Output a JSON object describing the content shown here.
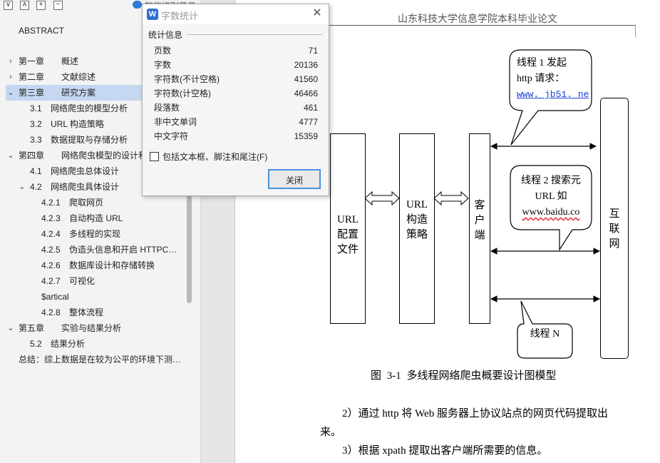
{
  "nav": {
    "pane_title": "智能识别目录",
    "top_buttons": [
      "∨",
      "∧",
      "+",
      "−"
    ],
    "items": [
      {
        "num": "",
        "text": "ABSTRACT",
        "level": 0,
        "chevron": ""
      },
      {
        "num": "第一章",
        "text": "概述",
        "level": 0,
        "chevron": "›"
      },
      {
        "num": "第二章",
        "text": "文献综述",
        "level": 0,
        "chevron": "›"
      },
      {
        "num": "第三章",
        "text": "研究方案",
        "level": 0,
        "chevron": "⌄",
        "selected": true
      },
      {
        "num": "3.1",
        "text": "网络爬虫的模型分析",
        "level": 1,
        "chevron": ""
      },
      {
        "num": "3.2",
        "text": "URL 构造策略",
        "level": 1,
        "chevron": ""
      },
      {
        "num": "3.3",
        "text": "数据提取与存储分析",
        "level": 1,
        "chevron": ""
      },
      {
        "num": "第四章",
        "text": "网络爬虫模型的设计和",
        "level": 0,
        "chevron": "⌄"
      },
      {
        "num": "4.1",
        "text": "网络爬虫总体设计",
        "level": 1,
        "chevron": ""
      },
      {
        "num": "4.2",
        "text": "网络爬虫具体设计",
        "level": 1,
        "chevron": "⌄"
      },
      {
        "num": "4.2.1",
        "text": "爬取网页",
        "level": 2,
        "chevron": ""
      },
      {
        "num": "4.2.3",
        "text": "自动构造 URL",
        "level": 2,
        "chevron": ""
      },
      {
        "num": "4.2.4",
        "text": "多线程的实现",
        "level": 2,
        "chevron": ""
      },
      {
        "num": "4.2.5",
        "text": "伪造头信息和开启 HTTPC…",
        "level": 2,
        "chevron": ""
      },
      {
        "num": "4.2.6",
        "text": "数据库设计和存储转换",
        "level": 2,
        "chevron": ""
      },
      {
        "num": "4.2.7",
        "text": "可视化",
        "level": 2,
        "chevron": ""
      },
      {
        "num": "",
        "text": "$artical",
        "level": 2,
        "chevron": ""
      },
      {
        "num": "4.2.8",
        "text": "整体流程",
        "level": 2,
        "chevron": ""
      },
      {
        "num": "第五章",
        "text": "实验与结果分析",
        "level": 0,
        "chevron": "⌄"
      },
      {
        "num": "5.2",
        "text": "结果分析",
        "level": 1,
        "chevron": ""
      },
      {
        "num": "",
        "text": "总结：综上数据是在较为公平的环境下测…",
        "level": 0,
        "chevron": ""
      }
    ]
  },
  "dialog": {
    "title": "字数统计",
    "icon_letter": "W",
    "close_glyph": "✕",
    "section": "统计信息",
    "stats": [
      {
        "label": "页数",
        "value": "71"
      },
      {
        "label": "字数",
        "value": "20136"
      },
      {
        "label": "字符数(不计空格)",
        "value": "41560"
      },
      {
        "label": "字符数(计空格)",
        "value": "46466"
      },
      {
        "label": "段落数",
        "value": "461"
      },
      {
        "label": "非中文单词",
        "value": "4777"
      },
      {
        "label": "中文字符",
        "value": "15359"
      }
    ],
    "checkbox_label": "包括文本框、脚注和尾注(F)",
    "checkbox_checked": false,
    "close_button": "关闭"
  },
  "document": {
    "running_header": "山东科技大学信息学院本科毕业论文",
    "diagram": {
      "box_url_config": [
        "URL",
        "配置",
        "文件"
      ],
      "box_url_strategy": [
        "URL",
        "构造",
        "策略"
      ],
      "box_client": [
        "客",
        "户",
        "端"
      ],
      "box_internet": [
        "互",
        "联",
        "网"
      ],
      "callout1": [
        "线程 1 发起",
        "http 请求：",
        "www. jb51. ne"
      ],
      "callout2": [
        "线程 2 搜索元",
        "URL 如",
        "www.baidu.co"
      ],
      "callout3": [
        "线程 N"
      ]
    },
    "figure_caption": "图 3-1    多线程网络爬虫概要设计图模型",
    "body": [
      "2）通过 http 将 Web 服务器上协议站点的网页代码提取出",
      "来。",
      "3）根据 xpath 提取出客户端所需要的信息。"
    ]
  }
}
